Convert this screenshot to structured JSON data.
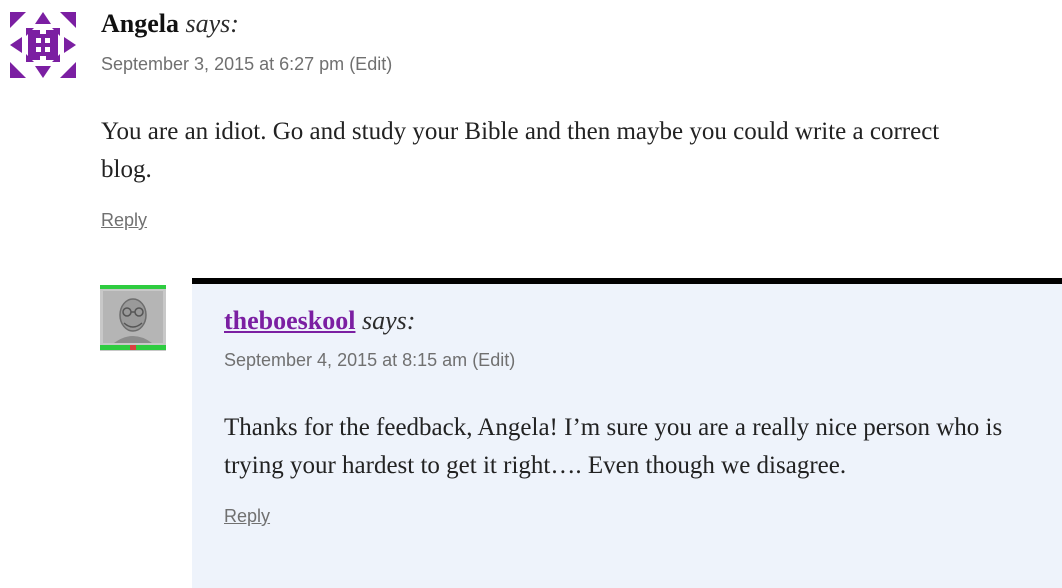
{
  "comments": [
    {
      "author": "Angela",
      "says": "says:",
      "date": "September 3, 2015 at 6:27 pm",
      "edit": "(Edit)",
      "text": "You are an idiot. Go and study your Bible and then maybe you could write a correct blog.",
      "reply": "Reply",
      "avatar_color": "#7b1fa2"
    },
    {
      "author": "theboeskool",
      "says": "says:",
      "date": "September 4, 2015 at 8:15 am",
      "edit": "(Edit)",
      "text": "Thanks for the feedback, Angela! I’m sure you are a really nice person who is trying your hardest to get it right…. Even though we disagree.",
      "reply": "Reply",
      "author_color": "#7b1fa2",
      "highlight_bg": "#eef3fb"
    }
  ]
}
